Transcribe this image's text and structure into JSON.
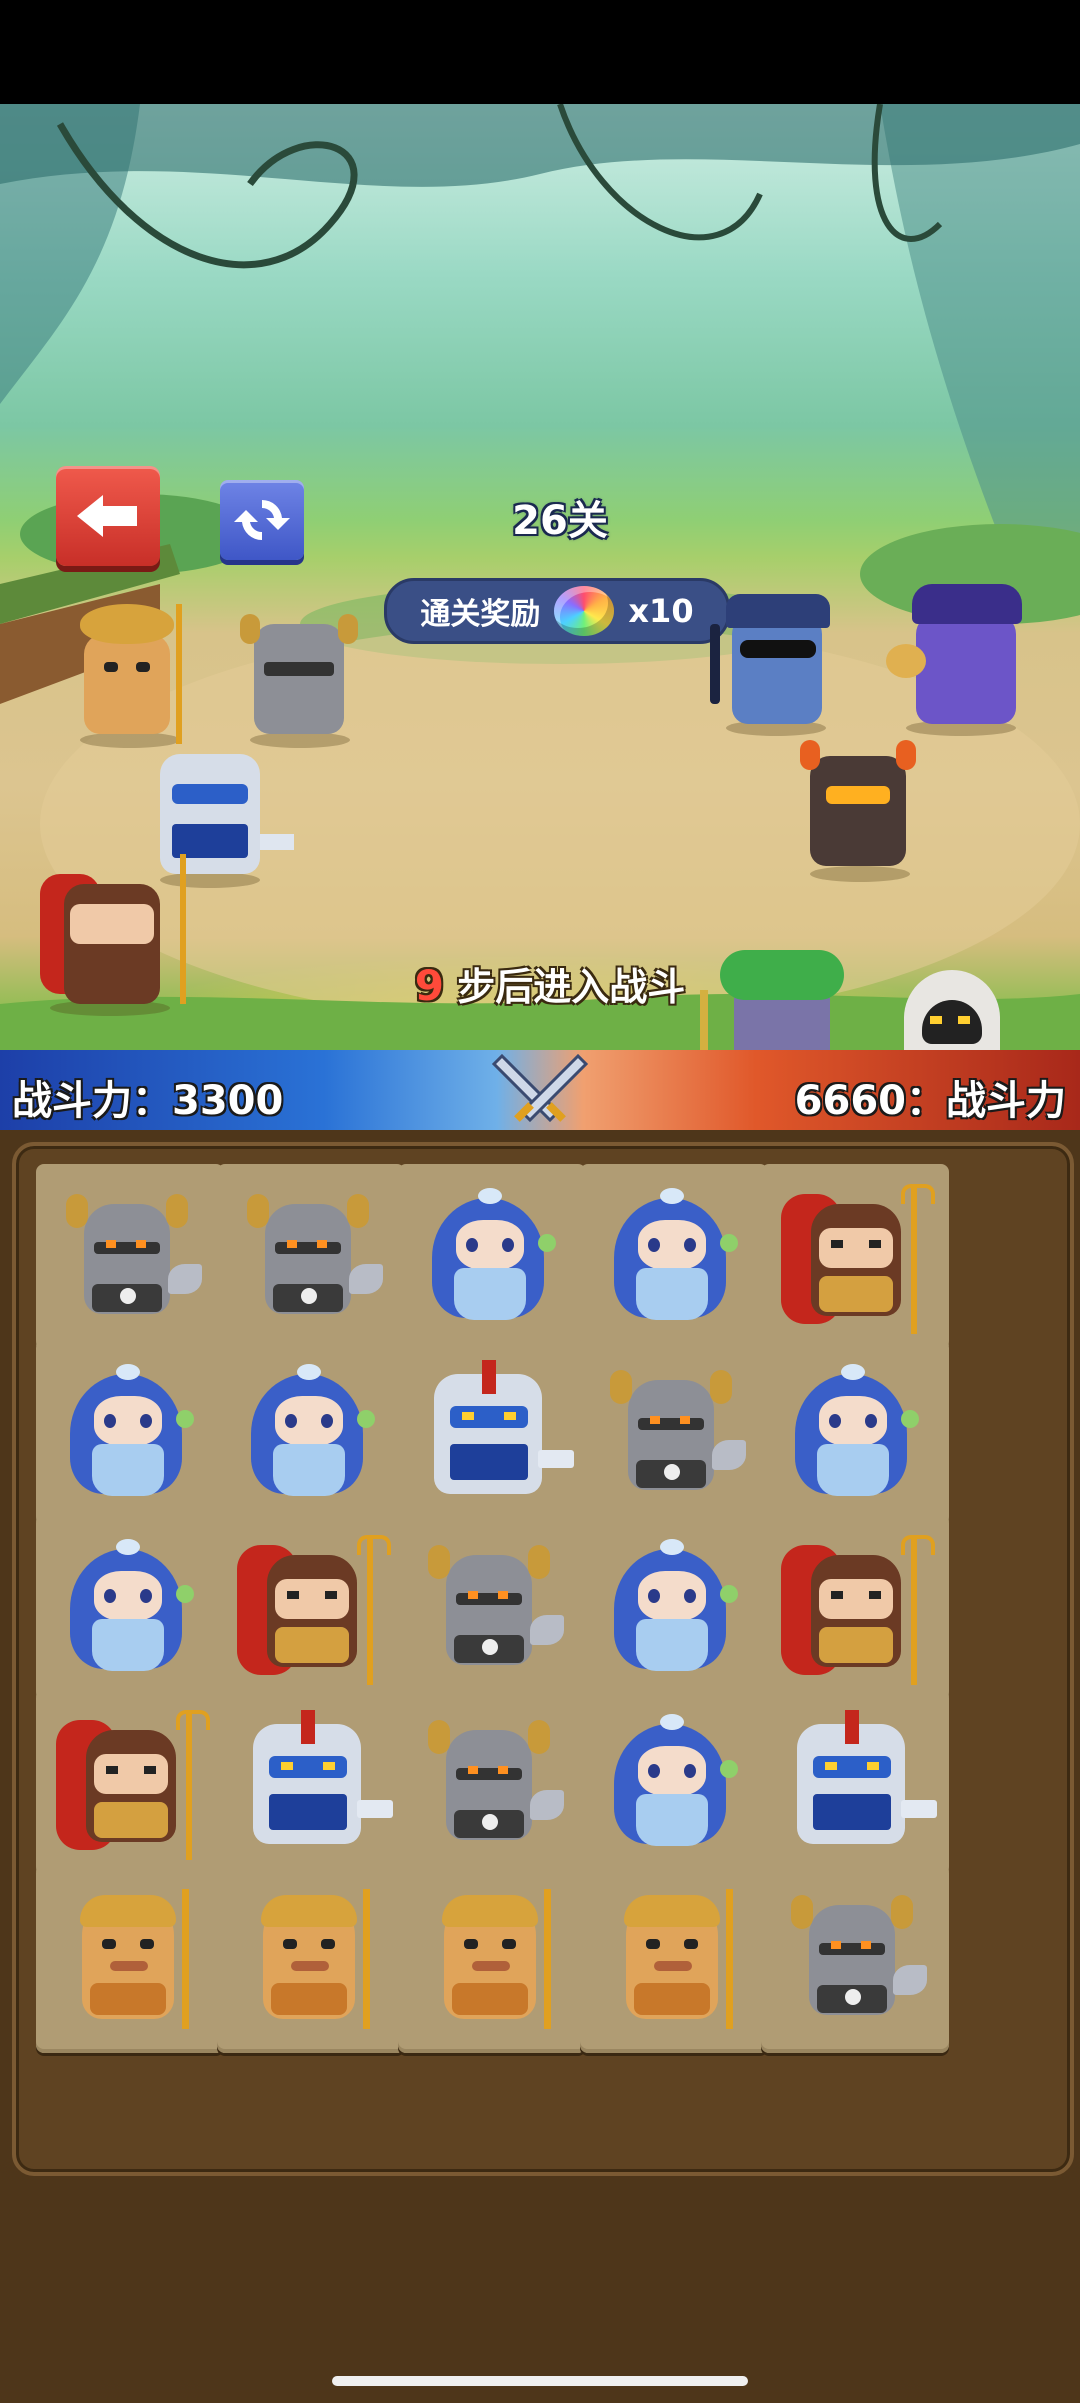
{
  "level": {
    "title": "26关"
  },
  "reward": {
    "label": "通关奖励",
    "count": "x10"
  },
  "battle": {
    "steps": "9",
    "steps_suffix": "步后进入战斗"
  },
  "power": {
    "player_text": "战斗力：3300",
    "enemy_text": "6660：战斗力"
  },
  "allies": [
    "monkey-king",
    "horned-knight",
    "robot",
    "red-warrior"
  ],
  "enemies": [
    "police-officer",
    "pirate-octopus",
    "lava-golem",
    "medusa",
    "hooded-mage"
  ],
  "board": {
    "rows": [
      [
        "horned-knight",
        "horned-knight",
        "blue-princess",
        "blue-princess",
        "red-warrior"
      ],
      [
        "blue-princess",
        "blue-princess",
        "robot",
        "horned-knight",
        "blue-princess"
      ],
      [
        "blue-princess",
        "red-warrior",
        "horned-knight",
        "blue-princess",
        "red-warrior"
      ],
      [
        "red-warrior",
        "robot",
        "horned-knight",
        "blue-princess",
        "robot"
      ],
      [
        "monkey-king",
        "monkey-king",
        "monkey-king",
        "monkey-king",
        "horned-knight"
      ]
    ]
  }
}
